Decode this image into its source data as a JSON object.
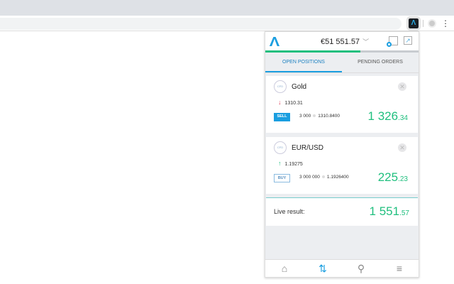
{
  "extension": {
    "logo": "Λ"
  },
  "header": {
    "balance": "€51 551.57",
    "progress_pct": 62
  },
  "tabs": [
    {
      "label": "OPEN POSITIONS",
      "active": true
    },
    {
      "label": "PENDING ORDERS",
      "active": false
    }
  ],
  "positions": [
    {
      "badge_type": "CFD",
      "name": "Gold",
      "direction": "down",
      "price": "1310.31",
      "side": "SELL",
      "quantity": "3 000",
      "open_price": "1310.8400",
      "pl_int": "1 326",
      "pl_dec": ".34"
    },
    {
      "badge_type": "CFD",
      "name": "EUR/USD",
      "direction": "up",
      "price": "1.19275",
      "side": "BUY",
      "quantity": "3 000 000",
      "open_price": "1.1926400",
      "pl_int": "225",
      "pl_dec": ".23"
    }
  ],
  "live": {
    "label": "Live result:",
    "int": "1 551",
    "dec": ".57"
  },
  "colors": {
    "accent": "#1a9ee0",
    "profit": "#1fbf7e",
    "down": "#e0405a"
  }
}
